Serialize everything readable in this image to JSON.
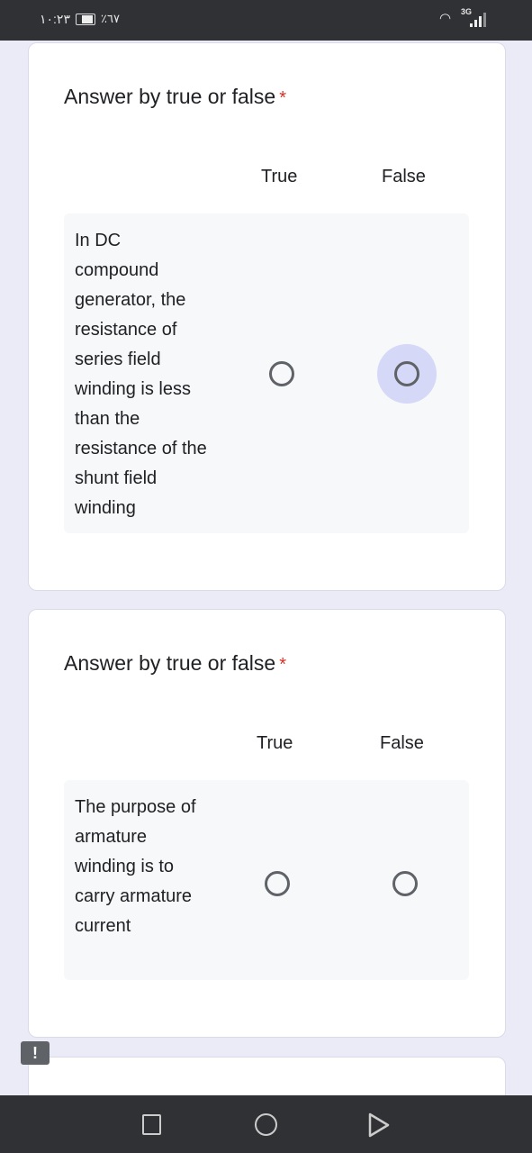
{
  "status_bar": {
    "time": "١٠:٢٣",
    "battery": "٪٦٧",
    "network": "3G",
    "wifi_icon": "wifi-icon",
    "signal_icon": "signal-icon"
  },
  "questions": [
    {
      "title": "Answer by true or false",
      "required_mark": "*",
      "columns": [
        "True",
        "False"
      ],
      "rows": [
        {
          "text": "In DC compound generator, the resistance of series field winding is less than the resistance of the shunt field winding",
          "selected": null,
          "focused": "False"
        }
      ]
    },
    {
      "title": "Answer by true or false",
      "required_mark": "*",
      "columns": [
        "True",
        "False"
      ],
      "rows": [
        {
          "text": "The purpose of armature winding is to carry armature current",
          "selected": null,
          "focused": null
        }
      ]
    }
  ],
  "flag_icon": {
    "label": "!"
  },
  "nav_bar": {
    "buttons": [
      "recents-button",
      "home-button",
      "back-button"
    ]
  }
}
